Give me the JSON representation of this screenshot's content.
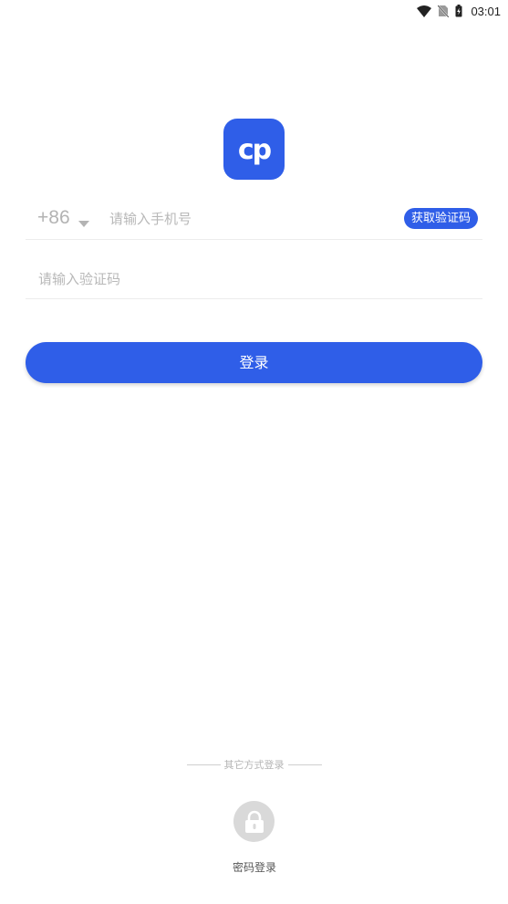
{
  "status_bar": {
    "time": "03:01",
    "icons": [
      "wifi-icon",
      "no-sim-icon",
      "battery-icon"
    ]
  },
  "logo": {
    "text": "cp",
    "color": "#2f5ee8"
  },
  "phone_row": {
    "country_code": "+86",
    "placeholder": "请输入手机号",
    "value": "",
    "get_code_label": "获取验证码"
  },
  "code_row": {
    "placeholder": "请输入验证码",
    "value": ""
  },
  "login_button": {
    "label": "登录"
  },
  "other_methods": {
    "divider_text": "其它方式登录",
    "password_login_label": "密码登录"
  },
  "colors": {
    "accent": "#2f5ee8",
    "placeholder": "#b8b8b8"
  }
}
